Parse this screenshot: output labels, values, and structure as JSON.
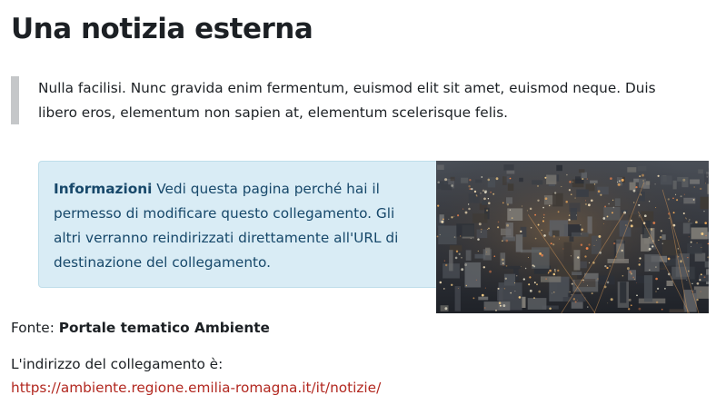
{
  "page": {
    "title": "Una notizia esterna"
  },
  "lead": {
    "text": "Nulla facilisi. Nunc gravida enim fermentum, euismod elit sit amet, euismod neque. Duis libero eros, elementum non sapien at, elementum scelerisque felis."
  },
  "info": {
    "strong_label": "Informazioni",
    "text": "Vedi questa pagina perché hai il permesso di modificare questo collegamento. Gli altri verranno reindirizzati direttamente all'URL di destinazione del collegamento."
  },
  "image": {
    "subject": "aerial city at dusk"
  },
  "source": {
    "label": "Fonte:",
    "name": "Portale tematico Ambiente"
  },
  "link": {
    "label": "L'indirizzo del collegamento è:",
    "url": "https://ambiente.regione.emilia-romagna.it/it/notizie/"
  },
  "colors": {
    "info_bg": "#d9ecf5",
    "info_text": "#17486a",
    "link": "#b22820",
    "lead_bar": "#c5c7c9"
  }
}
